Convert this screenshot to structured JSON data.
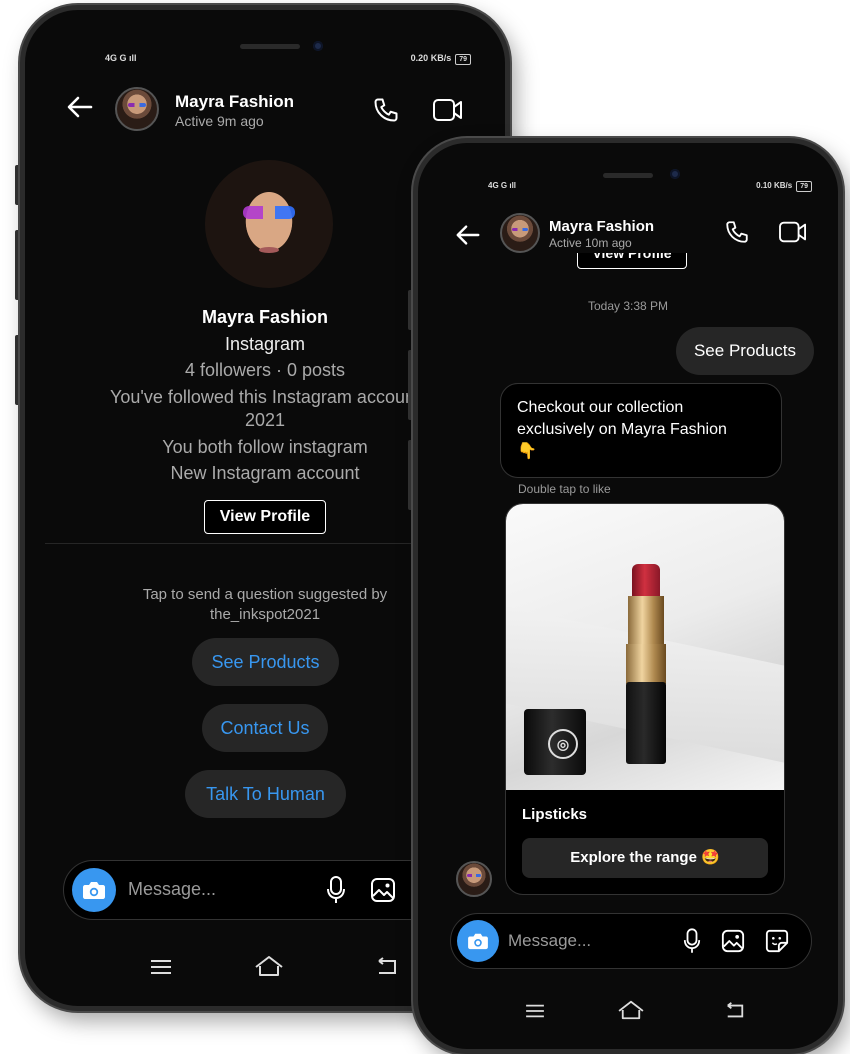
{
  "back_phone": {
    "status": {
      "left": "4G  G ıll",
      "right": "0.20 KB/s",
      "battery": "79"
    },
    "header": {
      "name": "Mayra Fashion",
      "status": "Active 9m ago"
    },
    "profile": {
      "name": "Mayra Fashion",
      "platform": "Instagram",
      "stats": "4 followers · 0 posts",
      "followed_line1": "You've followed this Instagram account",
      "followed_line2": "2021",
      "mutual": "You both follow instagram",
      "account_note": "New Instagram account",
      "view_profile": "View Profile"
    },
    "suggest": {
      "line1": "Tap to send a question suggested by",
      "line2": "the_inkspot2021"
    },
    "quick_replies": [
      "See Products",
      "Contact Us",
      "Talk To Human"
    ],
    "composer": {
      "placeholder": "Message..."
    }
  },
  "front_phone": {
    "status": {
      "left": "4G  G ıll",
      "right": "0.10 KB/s",
      "battery": "79"
    },
    "header": {
      "name": "Mayra Fashion",
      "status": "Active 10m ago"
    },
    "view_profile_partial": "View Profile",
    "timestamp": "Today 3:38 PM",
    "outgoing": "See Products",
    "incoming_line1": "Checkout our collection",
    "incoming_line2": "exclusively on Mayra Fashion",
    "incoming_emoji": "👇",
    "double_tap": "Double tap to like",
    "card": {
      "title": "Lipsticks",
      "button": "Explore the range 🤩"
    },
    "composer": {
      "placeholder": "Message..."
    }
  },
  "colors": {
    "accent": "#3897f0",
    "bg": "#000000",
    "bubble": "#262626"
  }
}
